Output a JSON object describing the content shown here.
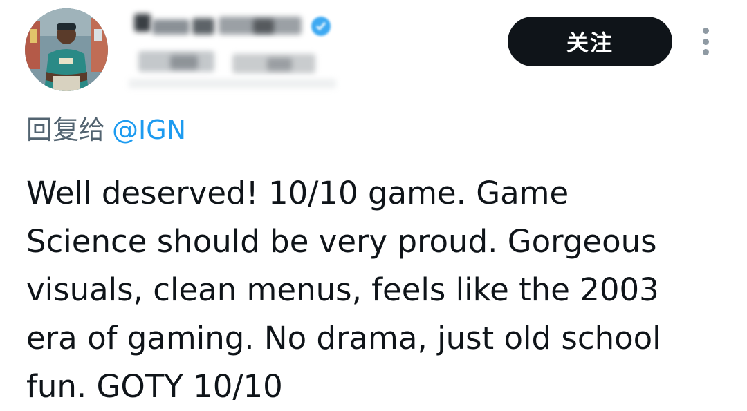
{
  "post": {
    "follow_label": "关注",
    "reply_prefix": "回复给",
    "reply_handle": "@IGN",
    "body_lines": [
      "Well deserved! 10/10 game. Game",
      "Science should be very proud. Gorgeous",
      "visuals, clean menus, feels like the 2003",
      "era of gaming. No drama, just old school",
      "fun. GOTY 10/10"
    ]
  },
  "icons": {
    "verified": "verified-badge-icon",
    "more": "more-options-icon"
  },
  "colors": {
    "text": "#0f1419",
    "secondary": "#536471",
    "link": "#1d9bf0",
    "button_bg": "#0f1419",
    "button_text": "#ffffff"
  }
}
